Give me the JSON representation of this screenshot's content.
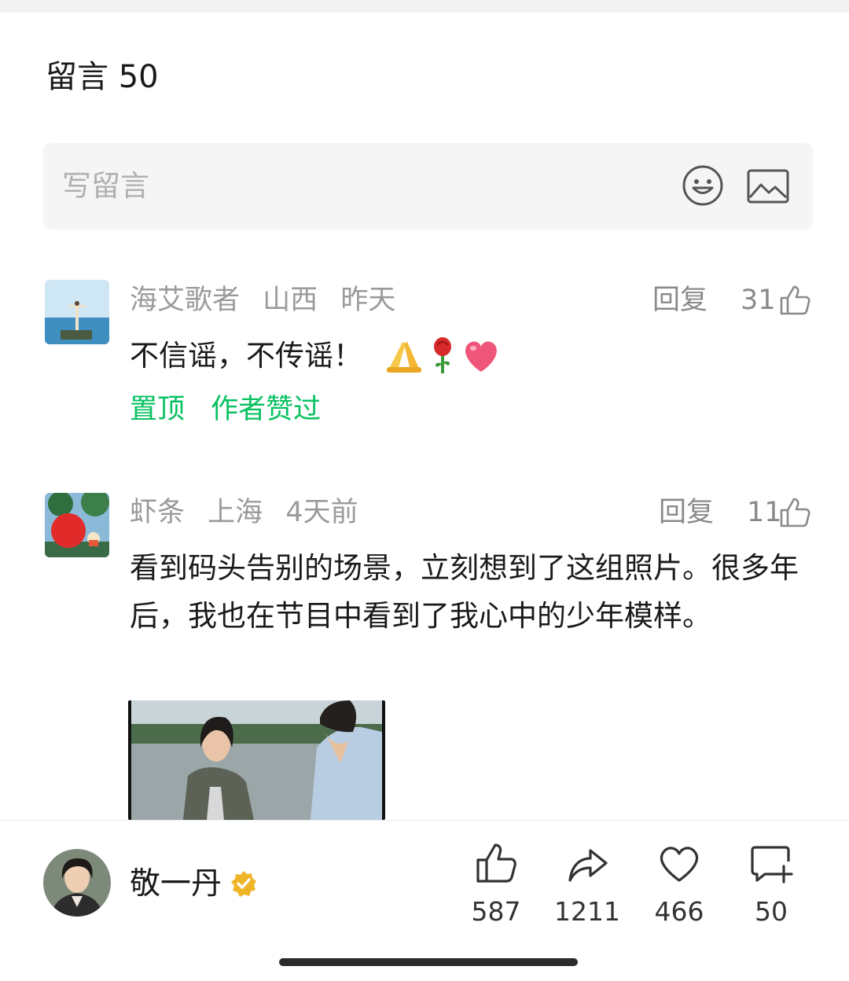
{
  "header": {
    "title": "留言 50"
  },
  "compose": {
    "placeholder": "写留言",
    "emoji_icon": "smiley-icon",
    "image_icon": "image-icon"
  },
  "comments": [
    {
      "user": "海艾歌者",
      "location": "山西",
      "time": "昨天",
      "reply_label": "回复",
      "likes": "31",
      "text": "不信谣，不传谣！",
      "emojis": [
        "pray-emoji",
        "rose-emoji",
        "heart-emoji"
      ],
      "tags": [
        "置顶",
        "作者赞过"
      ]
    },
    {
      "user": "虾条",
      "location": "上海",
      "time": "4天前",
      "reply_label": "回复",
      "likes": "11",
      "text": "看到码头告别的场景，立刻想到了这组照片。很多年后，我也在节目中看到了我心中的少年模样。"
    }
  ],
  "footer": {
    "author": "敬一丹",
    "verified_icon": "verified-badge-icon",
    "actions": [
      {
        "icon": "thumbs-up-icon",
        "count": "587"
      },
      {
        "icon": "share-icon",
        "count": "1211"
      },
      {
        "icon": "heart-icon",
        "count": "466"
      },
      {
        "icon": "comment-add-icon",
        "count": "50"
      }
    ]
  },
  "colors": {
    "accent_green": "#07c160",
    "meta_gray": "#9a9a9a",
    "verified_gold": "#f0b429"
  }
}
